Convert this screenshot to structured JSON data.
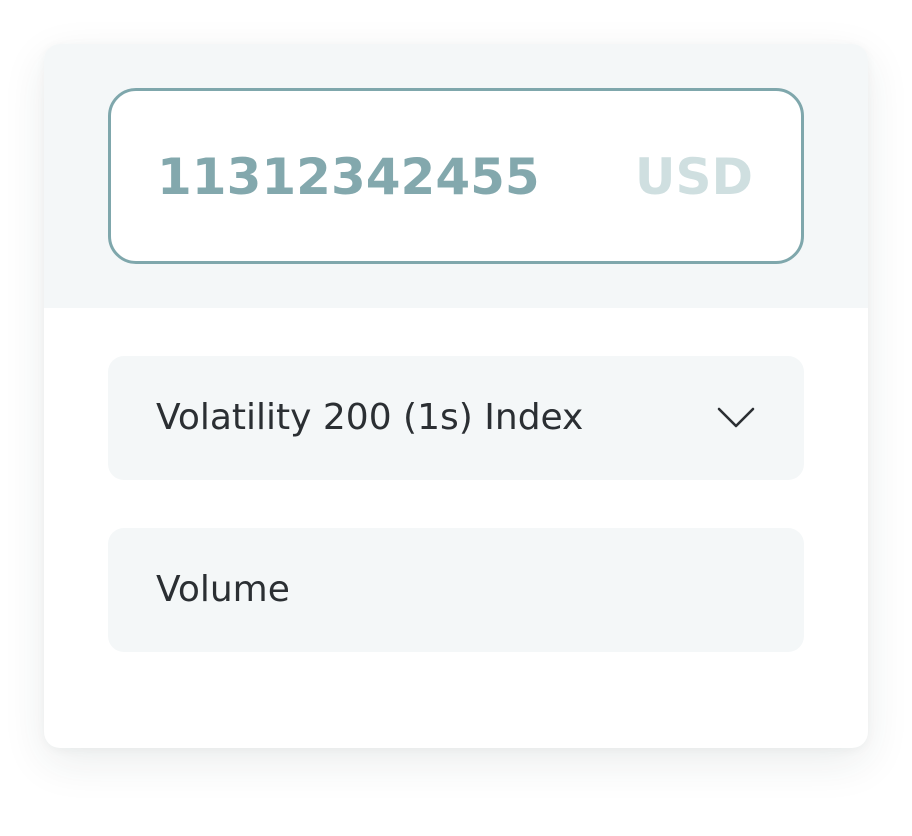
{
  "amount": {
    "value": "11312342455",
    "currency": "USD"
  },
  "market_select": {
    "selected": "Volatility 200 (1s) Index",
    "icon": "chevron-down-icon"
  },
  "trade_type": {
    "value": "Volume"
  },
  "colors": {
    "accent": "#7fa7ac",
    "amount_text": "#83a8ad",
    "currency_text": "#cfdfe0",
    "panel_bg": "#f4f7f8",
    "label_text": "#2b2f33"
  }
}
